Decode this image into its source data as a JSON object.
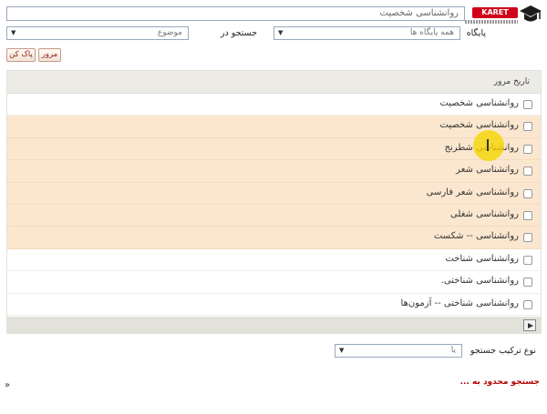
{
  "header": {
    "brand": "KARET",
    "search_value": "روانشناسی شخصیت"
  },
  "filters": {
    "database_label": "پایگاه",
    "database_value": "همه پایگاه ها",
    "search_in_label": "جستجو در",
    "field_value": "موضوع"
  },
  "buttons": {
    "browse": "مرور",
    "clear": "پاک کن"
  },
  "results": {
    "header": "تاریخ مرور",
    "items": [
      {
        "label": "روانشناسی شخصیت",
        "highlighted": false
      },
      {
        "label": "روانشناسی شخصیت",
        "highlighted": true
      },
      {
        "label": "روانشناسی شطرنج",
        "highlighted": true
      },
      {
        "label": "روانشناسی شعر",
        "highlighted": true
      },
      {
        "label": "روانشناسی شعر فارسی",
        "highlighted": true
      },
      {
        "label": "روانشناسی شغلی",
        "highlighted": true
      },
      {
        "label": "روانشناسی -- شکست",
        "highlighted": true
      },
      {
        "label": "روانشناسی شناخت",
        "highlighted": false
      },
      {
        "label": "روانشناسی شناختی.",
        "highlighted": false
      },
      {
        "label": "روانشناسی شناختی -- آزمون‌ها",
        "highlighted": false
      }
    ]
  },
  "combination": {
    "label": "نوع ترکیب جستجو",
    "value": "یا"
  },
  "limit_text": "جستجو محدود به ...",
  "expand_glyph": "»"
}
